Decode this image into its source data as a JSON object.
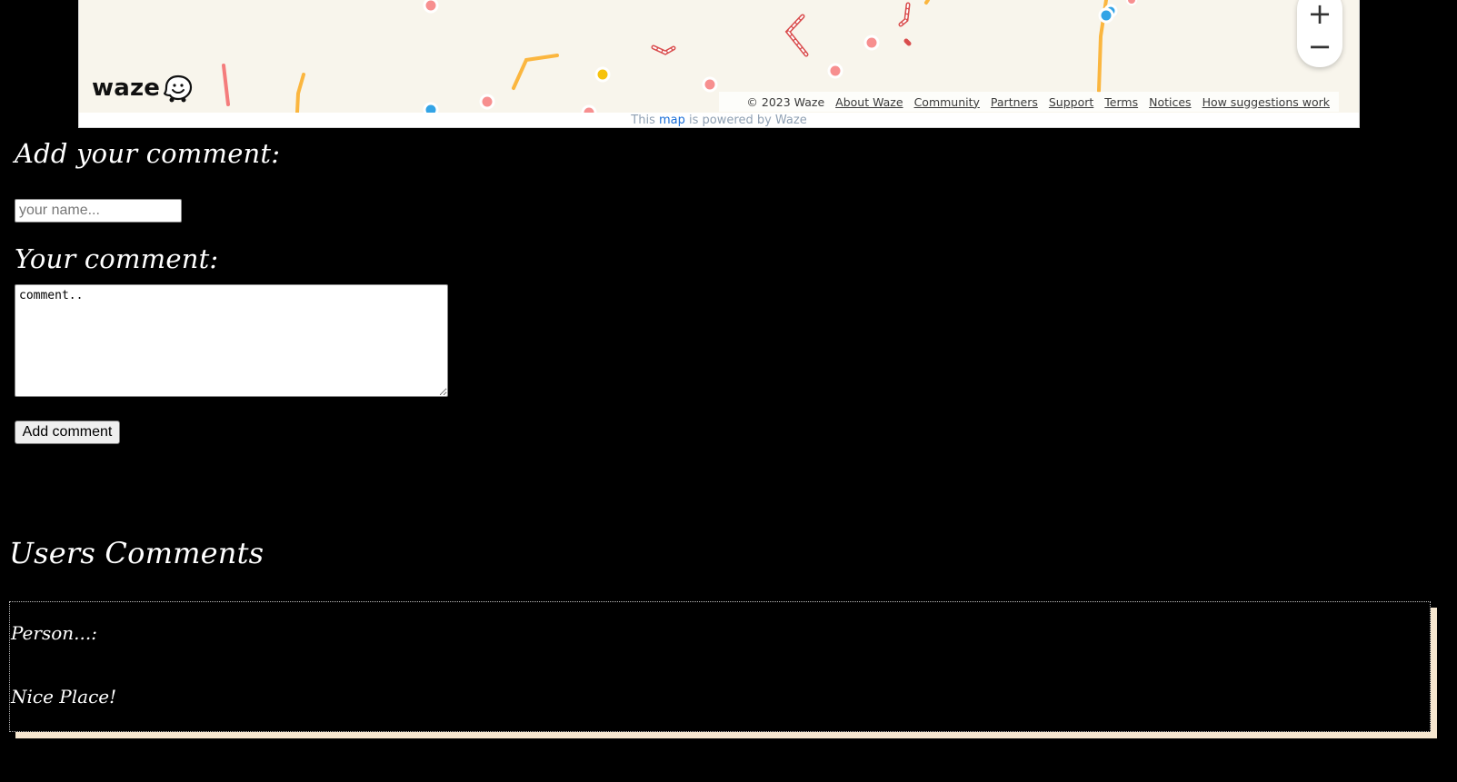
{
  "map": {
    "logo_text": "waze",
    "zoom_in_label": "+",
    "zoom_out_label": "−",
    "copyright": "© 2023 Waze",
    "links": [
      "About Waze",
      "Community",
      "Partners",
      "Support",
      "Terms",
      "Notices",
      "How suggestions work"
    ],
    "powered_prefix": "This",
    "powered_link": "map",
    "powered_suffix": "is powered by Waze",
    "colors": {
      "map_bg": "#f8f5ec",
      "road_yellow": "#fbb63f",
      "road_red": "#f47c7c",
      "pin_red": "#f78f8f",
      "pin_blue": "#33a4e6",
      "pin_yellow": "#f6c20d",
      "link_blue": "#1a6ed8"
    }
  },
  "form": {
    "add_heading": "Add your comment:",
    "name_placeholder": "your name...",
    "comment_heading": "Your comment:",
    "comment_value": "comment..",
    "submit_label": "Add comment"
  },
  "comments": {
    "heading": "Users Comments",
    "items": [
      {
        "author": "Person...:",
        "text": "Nice Place!"
      }
    ]
  }
}
